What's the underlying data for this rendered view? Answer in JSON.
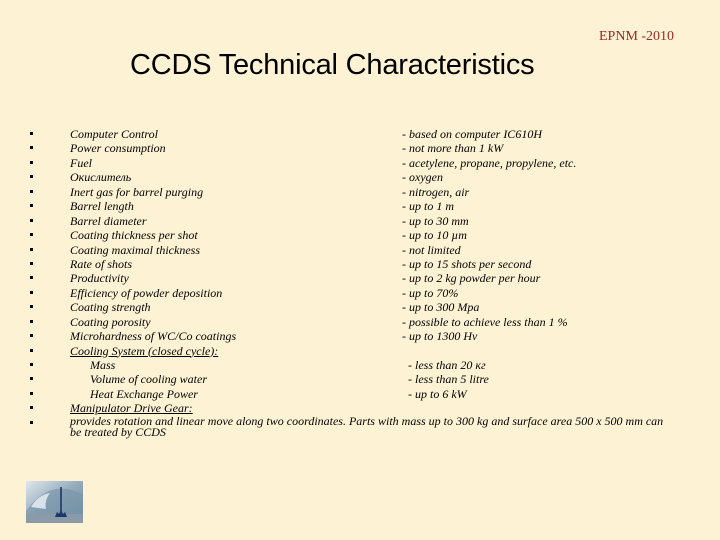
{
  "header": {
    "tag": "EPNM -2010",
    "title": "CCDS Technical Characteristics"
  },
  "rows": [
    {
      "label": "Computer Control",
      "value": "-  based on computer  IC610H"
    },
    {
      "label": "Power  consumption",
      "value": "- not more than 1 kW"
    },
    {
      "label": "Fuel",
      "value": "-  acetylene, propane, propylene, etc."
    },
    {
      "label": "Окислитель",
      "value": "- oxygen"
    },
    {
      "label": "Inert gas for barrel purging",
      "value": "- nitrogen, air"
    },
    {
      "label": "Barrel length",
      "value": "- up to 1 m"
    },
    {
      "label": "Barrel diameter",
      "value": "- up to 30 mm"
    },
    {
      "label": "Coating thickness per shot",
      "value": "- up to 10 µm"
    },
    {
      "label": "Coating maximal thickness",
      "value": "- not limited"
    },
    {
      "label": "Rate of shots",
      "value": "- up to  15 shots per second"
    },
    {
      "label": "Productivity",
      "value": "- up to 2 kg powder per hour"
    },
    {
      "label": "Efficiency of powder deposition",
      "value": "- up to 70%"
    },
    {
      "label": "Coating strength",
      "value": "- up to 300 Mpa"
    },
    {
      "label": "Coating porosity",
      "value": "- possible to achieve less than 1 %"
    },
    {
      "label": "Microhardness of WC/Co coatings",
      "value": "- up to 1300 Hv"
    },
    {
      "label": "Cooling System (closed cycle):",
      "value": ""
    },
    {
      "label": "Mass",
      "value": "- less than 20 кг"
    },
    {
      "label": "Volume of cooling water",
      "value": "- less than 5 litre"
    },
    {
      "label": "Heat Exchange Power",
      "value": "- up to 6 kW"
    },
    {
      "label": "Manipulator Drive Gear:",
      "value": ""
    },
    {
      "label": " provides rotation and linear move along two coordinates. Parts with mass up to 300 kg and surface area 500 x 500 mm can be treated by  CCDS",
      "value": ""
    }
  ],
  "logo": {
    "icon": "wave-ship-logo"
  }
}
